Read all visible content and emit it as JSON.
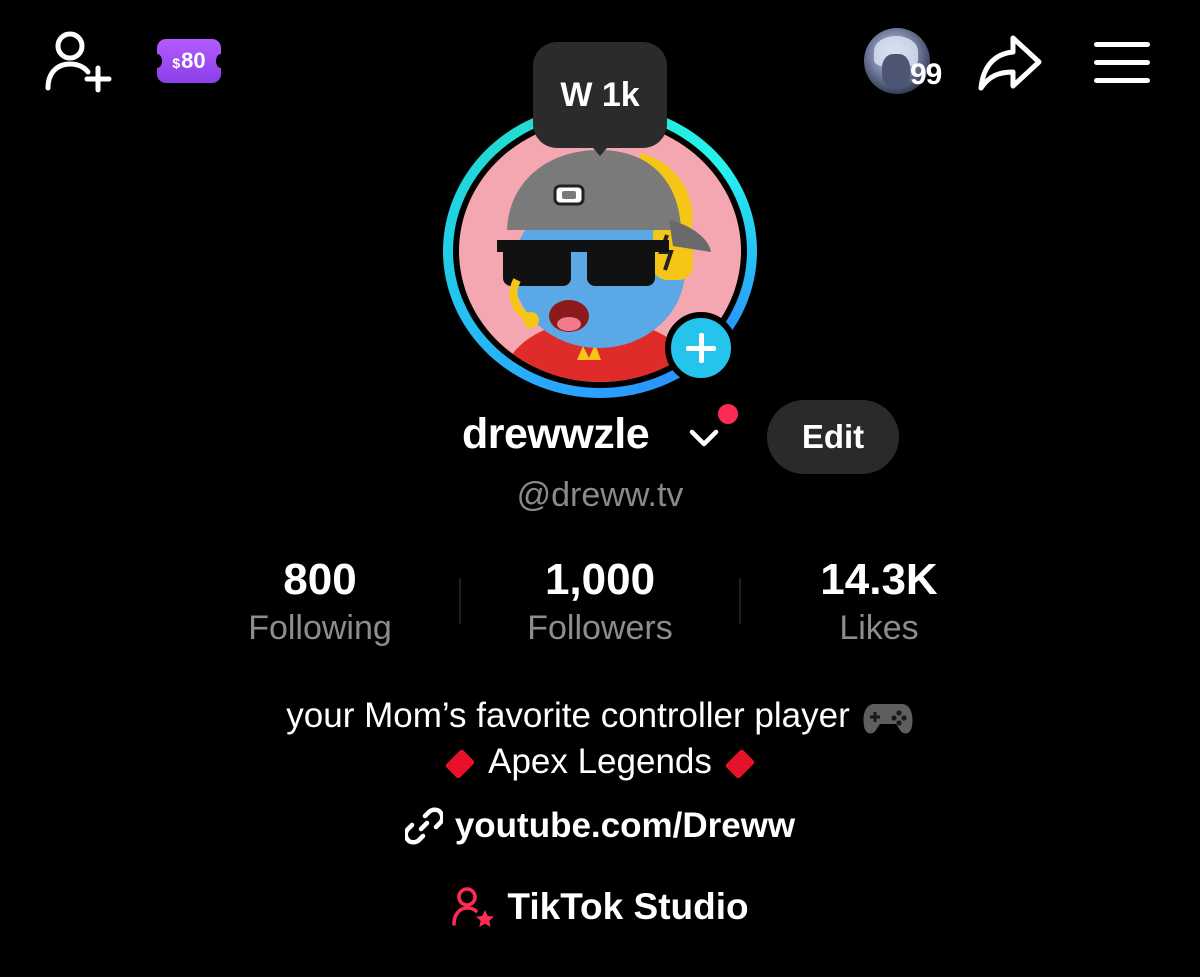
{
  "header": {
    "coin_badge": {
      "currency": "$",
      "amount": "80"
    },
    "notification_count": "99",
    "icons": [
      "add-friend-icon",
      "share-icon",
      "menu-icon"
    ]
  },
  "profile": {
    "tooltip": "W 1k",
    "display_name": "drewwzle",
    "edit_label": "Edit",
    "handle": "@dreww.tv"
  },
  "stats": [
    {
      "value": "800",
      "label": "Following"
    },
    {
      "value": "1,000",
      "label": "Followers"
    },
    {
      "value": "14.3K",
      "label": "Likes"
    }
  ],
  "bio": {
    "line1": "your Mom’s favorite controller player",
    "line2": "Apex Legends"
  },
  "link": {
    "text": "youtube.com/Dreww"
  },
  "studio": {
    "label": "TikTok Studio"
  },
  "colors": {
    "background": "#000000",
    "accent_red": "#fe2c55",
    "accent_cyan": "#25c4ec",
    "badge_purple": "#9b4dff",
    "muted_text": "#8a8a8a"
  }
}
